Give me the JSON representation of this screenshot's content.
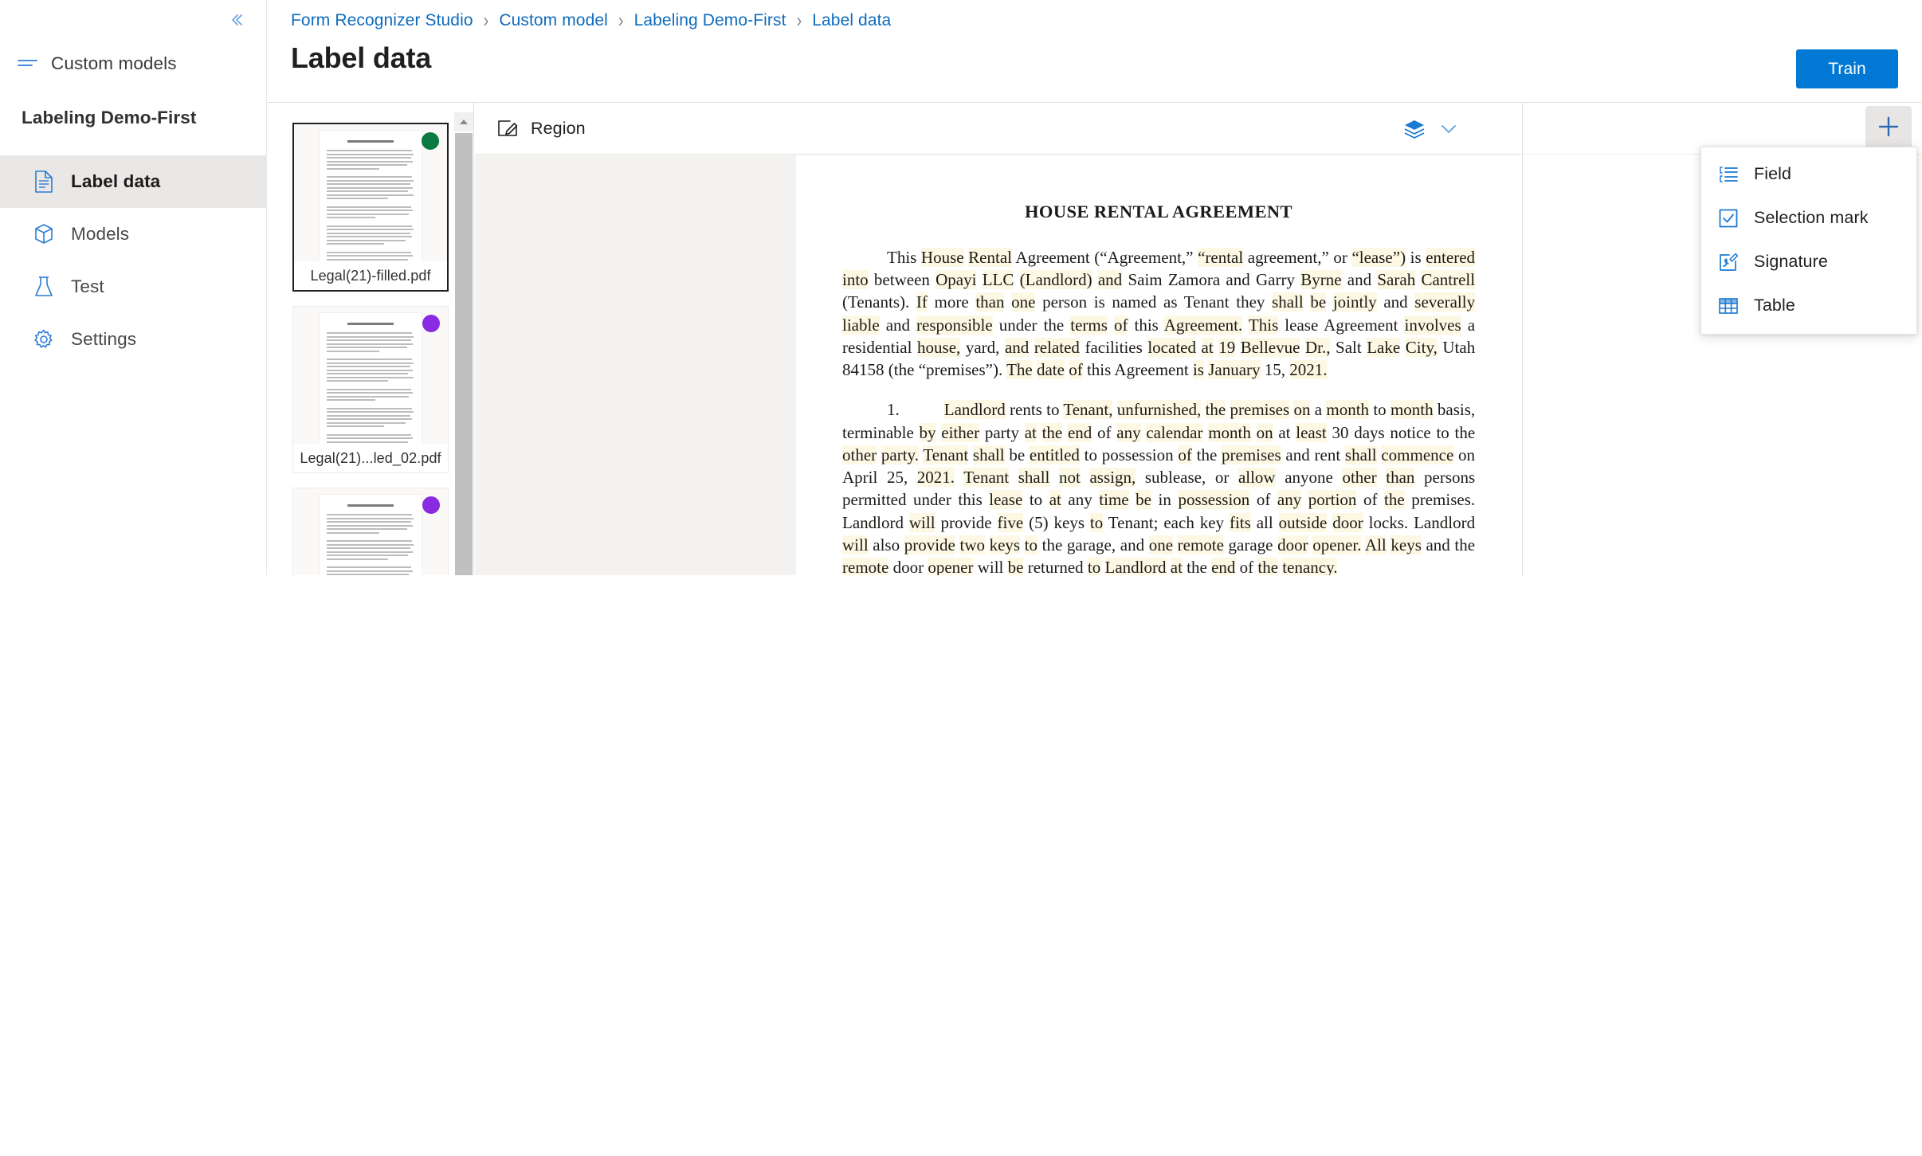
{
  "sidebar": {
    "collapse_icon": "chevron-double-left-icon",
    "custom_models": {
      "label": "Custom models",
      "icon": "menu-lines-icon"
    },
    "project_title": "Labeling Demo-First",
    "items": [
      {
        "label": "Label data",
        "icon": "document-icon",
        "active": true
      },
      {
        "label": "Models",
        "icon": "box-icon",
        "active": false
      },
      {
        "label": "Test",
        "icon": "flask-icon",
        "active": false
      },
      {
        "label": "Settings",
        "icon": "gear-icon",
        "active": false
      }
    ]
  },
  "header": {
    "breadcrumb": [
      "Form Recognizer Studio",
      "Custom model",
      "Labeling Demo-First",
      "Label data"
    ],
    "breadcrumb_separator": "›",
    "page_title": "Label data",
    "train_label": "Train",
    "accent_color": "#0078d4",
    "link_color": "#0f6cbd"
  },
  "file_panel": {
    "files": [
      {
        "name": "Legal(21)-filled.pdf",
        "status_color": "#0b7a41",
        "selected": true
      },
      {
        "name": "Legal(21)...led_02.pdf",
        "status_color": "#8a2be2",
        "selected": false
      },
      {
        "name": "",
        "status_color": "#8a2be2",
        "selected": false
      }
    ],
    "scroll_up_icon": "triangle-up-icon"
  },
  "viewer": {
    "toolbar": {
      "region_label": "Region",
      "region_icon": "region-draw-icon",
      "layers_icon": "layers-icon",
      "chevron_icon": "chevron-down-icon"
    },
    "document": {
      "title": "HOUSE RENTAL AGREEMENT",
      "paragraphs": [
        "This House Rental Agreement (“Agreement,” “rental agreement,” or “lease”) is entered into between Opayi LLC (Landlord) and Saim Zamora and Garry Byrne and Sarah Cantrell (Tenants).   If more than one person is named as Tenant they shall be jointly and severally liable and responsible under the terms of this Agreement.  This lease Agreement involves a residential house, yard, and related facilities located at 19 Bellevue Dr., Salt Lake City, Utah 84158 (the “premises”). The date of this Agreement is January 15, 2021.",
        "Landlord rents to Tenant, unfurnished, the premises on a month to month basis, terminable by either party at the end of any calendar month on at least 30 days notice to the other party.  Tenant shall be entitled to possession of the premises and rent shall commence on April 25, 2021.  Tenant shall not assign, sublease, or allow anyone other than persons permitted under this lease to at any time be in possession of any portion of the premises.  Landlord will provide five (5) keys to Tenant; each key fits all outside door locks.  Landlord will also provide two keys to the garage, and one remote garage door opener.  All keys and the remote door opener will be returned to Landlord at the end of the tenancy."
      ],
      "paragraph_number": "1."
    }
  },
  "label_panel": {
    "add_icon": "plus-icon",
    "add_tooltip": "Add"
  },
  "dropdown": {
    "items": [
      {
        "label": "Field",
        "icon": "field-list-icon"
      },
      {
        "label": "Selection mark",
        "icon": "checkbox-icon"
      },
      {
        "label": "Signature",
        "icon": "signature-icon"
      },
      {
        "label": "Table",
        "icon": "table-icon"
      }
    ]
  }
}
